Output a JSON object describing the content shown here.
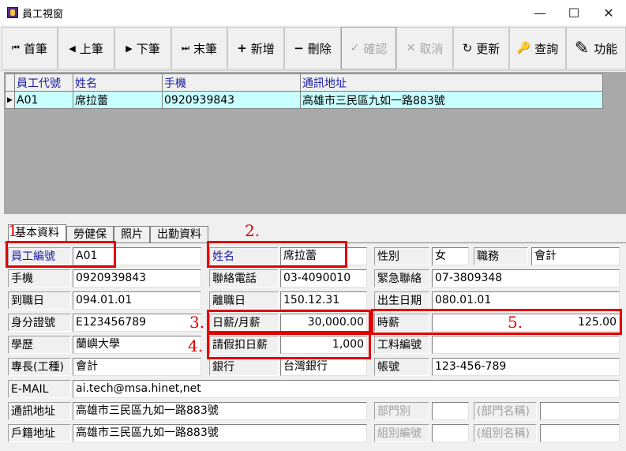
{
  "window": {
    "title": "員工視窗",
    "minimize": "—",
    "maximize": "☐",
    "close": "✕"
  },
  "toolbar": {
    "first": "首筆",
    "prev": "上筆",
    "next": "下筆",
    "last": "末筆",
    "add": "新增",
    "delete": "刪除",
    "confirm": "確認",
    "cancel": "取消",
    "refresh": "更新",
    "query": "查詢",
    "function": "功能"
  },
  "grid": {
    "columns": [
      "員工代號",
      "姓名",
      "手機",
      "通訊地址"
    ],
    "rows": [
      [
        "A01",
        "席拉蕾",
        "0920939843",
        "高雄市三民區九如一路883號"
      ]
    ]
  },
  "tabs": [
    "基本資料",
    "勞健保",
    "照片",
    "出勤資料"
  ],
  "annotations": [
    "1.",
    "2.",
    "3.",
    "4.",
    "5."
  ],
  "form": {
    "emp_no_label": "員工編號",
    "emp_no": "A01",
    "name_label": "姓名",
    "name": "席拉蕾",
    "gender_label": "性別",
    "gender": "女",
    "position_label": "職務",
    "position": "會計",
    "mobile_label": "手機",
    "mobile": "0920939843",
    "phone_label": "聯絡電話",
    "phone": "03-4090010",
    "emergency_label": "緊急聯絡",
    "emergency": "07-3809348",
    "hire_label": "到職日",
    "hire": "094.01.01",
    "leave_label": "離職日",
    "leave": "150.12.31",
    "birth_label": "出生日期",
    "birth": "080.01.01",
    "id_label": "身分證號",
    "id": "E123456789",
    "salary_label": "日薪/月薪",
    "salary": "30,000.00",
    "hourly_label": "時薪",
    "hourly": "125.00",
    "edu_label": "學歷",
    "edu": "蘭嶼大學",
    "deduct_label": "請假扣日薪",
    "deduct": "1,000",
    "cost_label": "工料編號",
    "cost": "",
    "skill_label": "專長(工種)",
    "skill": "會計",
    "bank_label": "銀行",
    "bank": "台灣銀行",
    "account_label": "帳號",
    "account": "123-456-789",
    "email_label": "E-MAIL",
    "email": "ai.tech@msa.hinet,net",
    "addr_label": "通訊地址",
    "addr": "高雄市三民區九如一路883號",
    "dept_label": "部門別",
    "dept": "",
    "dept_name_label": "(部門名稱)",
    "dept_name": "",
    "reg_addr_label": "戶籍地址",
    "reg_addr": "高雄市三民區九如一路883號",
    "group_label": "組別編號",
    "group": "",
    "group_name_label": "(組別名稱)",
    "group_name": ""
  }
}
